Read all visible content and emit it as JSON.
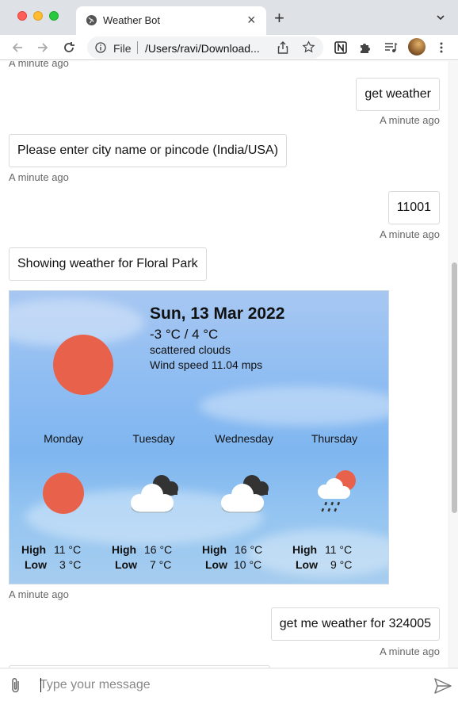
{
  "browser": {
    "tab_title": "Weather Bot",
    "omnibox_scheme": "File",
    "omnibox_url": "/Users/ravi/Download..."
  },
  "chat": {
    "partial_timestamp": "A minute ago",
    "messages": [
      {
        "from": "user",
        "text": "get weather",
        "time": "A minute ago"
      },
      {
        "from": "bot",
        "text": "Please enter city name or pincode (India/USA)",
        "time": "A minute ago"
      },
      {
        "from": "user",
        "text": "11001",
        "time": "A minute ago"
      },
      {
        "from": "bot",
        "text": "Showing weather for Floral Park"
      },
      {
        "from": "bot_card_time",
        "time": "A minute ago"
      },
      {
        "from": "user",
        "text": "get me weather for 324005",
        "time": "A minute ago"
      }
    ]
  },
  "weather": {
    "date": "Sun, 13 Mar 2022",
    "temp_range": "-3 °C / 4 °C",
    "description": "scattered clouds",
    "wind": "Wind speed 11.04 mps",
    "high_label": "High",
    "low_label": "Low",
    "forecast": [
      {
        "day": "Monday",
        "icon": "sun-icon",
        "high": "11 °C",
        "low": "3 °C"
      },
      {
        "day": "Tuesday",
        "icon": "cloudy-icon",
        "high": "16 °C",
        "low": "7 °C"
      },
      {
        "day": "Wednesday",
        "icon": "cloudy-icon",
        "high": "16 °C",
        "low": "10 °C"
      },
      {
        "day": "Thursday",
        "icon": "sun-rain-icon",
        "high": "11 °C",
        "low": "9 °C"
      }
    ],
    "colors": {
      "sun": "#e8624b",
      "sky": "#8fbdf2"
    }
  },
  "composer": {
    "placeholder": "Type your message",
    "value": ""
  }
}
